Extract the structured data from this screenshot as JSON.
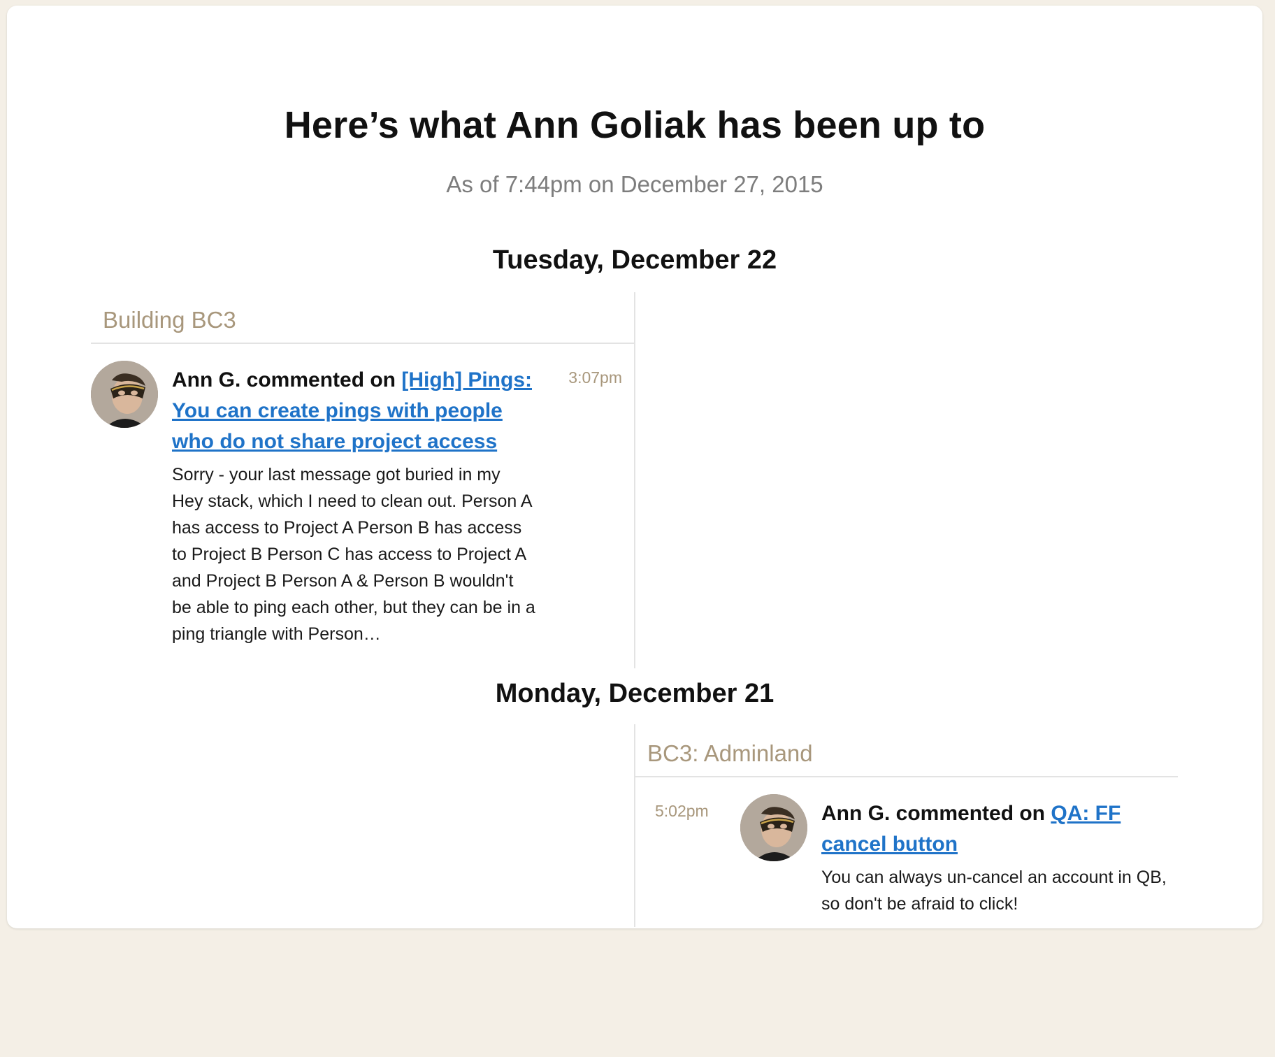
{
  "page": {
    "title": "Here’s what Ann Goliak has been up to",
    "subtitle": "As of 7:44pm on December 27, 2015"
  },
  "days": [
    {
      "heading": "Tuesday, December 22",
      "bucket": {
        "title": "Building BC3",
        "side": "left",
        "event": {
          "actor": "Ann G. commented on",
          "link_text": "[High] Pings: You can create pings with people who do not share project access",
          "time": "3:07pm",
          "excerpt": "Sorry - your last message got buried in my Hey stack, which I need to clean out. Person A has access to Project A Person B has access to Project B Person C has access to Project A and Project B Person A & Person B wouldn't be able to ping each other, but they can be in a ping triangle with Person…",
          "avatar_icon": "avatar-masked-person"
        }
      }
    },
    {
      "heading": "Monday, December 21",
      "bucket": {
        "title": "BC3: Adminland",
        "side": "right",
        "event": {
          "actor": "Ann G. commented on",
          "link_text": "QA: FF cancel button",
          "time": "5:02pm",
          "excerpt": "You can always un-cancel an account in QB, so don't be afraid to click!",
          "avatar_icon": "avatar-masked-person"
        }
      }
    }
  ],
  "colors": {
    "background": "#f4efe6",
    "card": "#ffffff",
    "bucket_title": "#a8977c",
    "link": "#1f73c8",
    "subtitle": "#7d7d7d"
  }
}
